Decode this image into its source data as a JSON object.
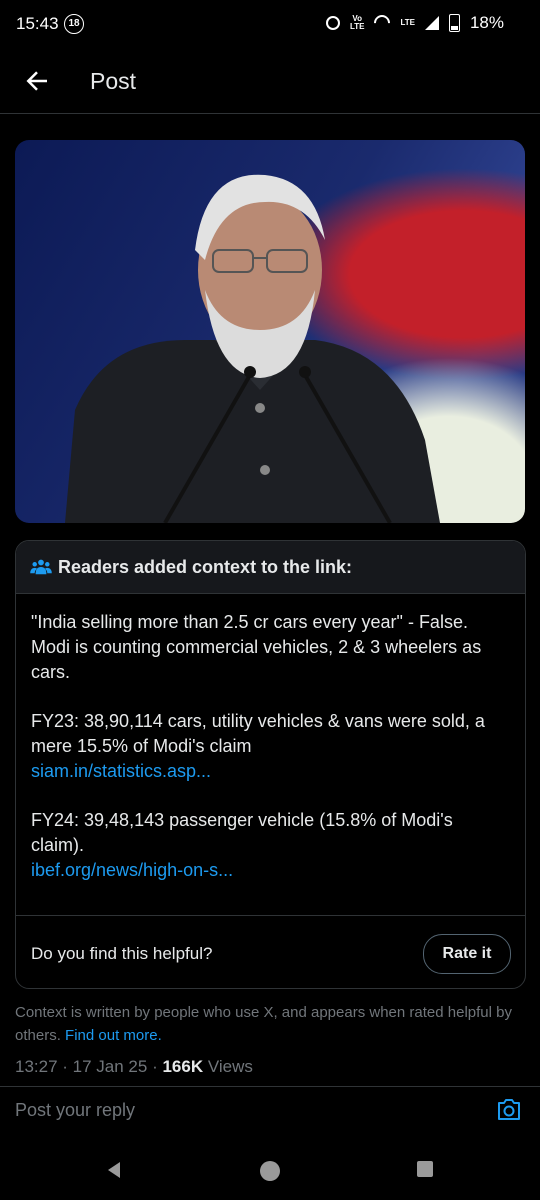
{
  "status_bar": {
    "time": "15:43",
    "age_badge": "18",
    "network": "LTE",
    "battery_percent": "18%",
    "icons": [
      "alarm-icon",
      "volte-icon",
      "hotspot-icon",
      "lte-signal-icon",
      "battery-icon"
    ]
  },
  "header": {
    "title": "Post",
    "back_icon": "arrow-left-icon"
  },
  "context_card": {
    "heading": "Readers added context to the link:",
    "paragraph1": "\"India selling more than 2.5 cr cars every year\" - False. Modi is counting commercial vehicles, 2 & 3 wheelers as cars.",
    "paragraph2_text": "FY23: 38,90,114 cars, utility vehicles & vans were sold, a mere 15.5% of Modi's claim",
    "paragraph2_link": "siam.in/statistics.asp...",
    "paragraph3_text": "FY24: 39,48,143 passenger vehicle (15.8% of Modi's claim).",
    "paragraph3_link": "ibef.org/news/high-on-s...",
    "helpful_question": "Do you find this helpful?",
    "rate_button": "Rate it"
  },
  "disclaimer": {
    "text": "Context is written by people who use X, and appears when rated helpful by others.",
    "link": "Find out more."
  },
  "meta": {
    "time": "13:27",
    "date": "17 Jan 25",
    "views_count": "166K",
    "views_label": "Views"
  },
  "reply": {
    "placeholder": "Post your reply",
    "camera_icon": "camera-icon"
  },
  "colors": {
    "background": "#000000",
    "link": "#1d9bf0",
    "muted": "#71767b",
    "border": "#2f3336"
  }
}
